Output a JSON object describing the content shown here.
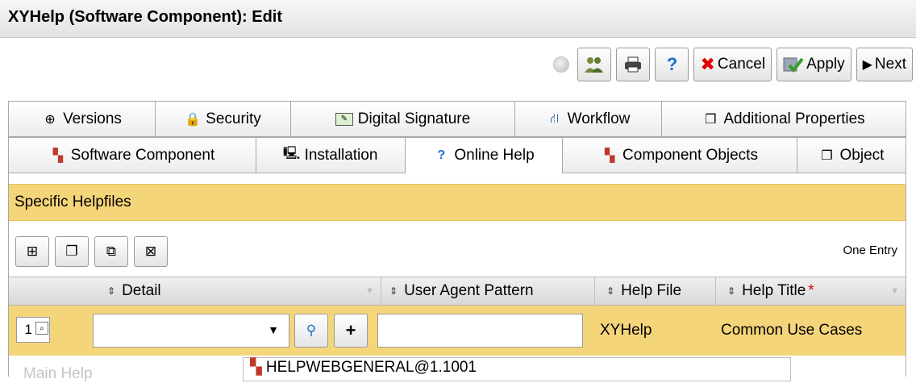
{
  "window": {
    "title": "XYHelp (Software Component): Edit"
  },
  "toolbar": {
    "cancel_label": "Cancel",
    "apply_label": "Apply",
    "next_label": "Next",
    "help_label": "?"
  },
  "tabs_row1": [
    {
      "label": "Versions",
      "icon": "globe-icon"
    },
    {
      "label": "Security",
      "icon": "lock-icon"
    },
    {
      "label": "Digital Signature",
      "icon": "signature-icon"
    },
    {
      "label": "Workflow",
      "icon": "workflow-icon"
    },
    {
      "label": "Additional Properties",
      "icon": "cube-icon"
    }
  ],
  "tabs_row2": [
    {
      "label": "Software Component",
      "icon": "component-icon"
    },
    {
      "label": "Installation",
      "icon": "computer-icon"
    },
    {
      "label": "Online Help",
      "icon": "question-icon",
      "active": true
    },
    {
      "label": "Component Objects",
      "icon": "component-objects-icon"
    },
    {
      "label": "Object",
      "icon": "cube-icon"
    }
  ],
  "section": {
    "title": "Specific Helpfiles",
    "entry_count": "One Entry"
  },
  "grid": {
    "columns": [
      "Detail",
      "User Agent Pattern",
      "Help File",
      "Help Title"
    ],
    "required_marker": "*",
    "rows": [
      {
        "index": "1",
        "detail": "",
        "user_agent_pattern": "",
        "help_file": "XYHelp",
        "help_title": "Common Use Cases"
      }
    ]
  },
  "bottom": {
    "label": "Main Help",
    "value": "HELPWEBGENERAL@1.1001"
  },
  "colors": {
    "accent": "#f5d57a",
    "cancel_red": "#e00000",
    "apply_green": "#3a9c2f",
    "help_blue": "#1b6fd1"
  }
}
